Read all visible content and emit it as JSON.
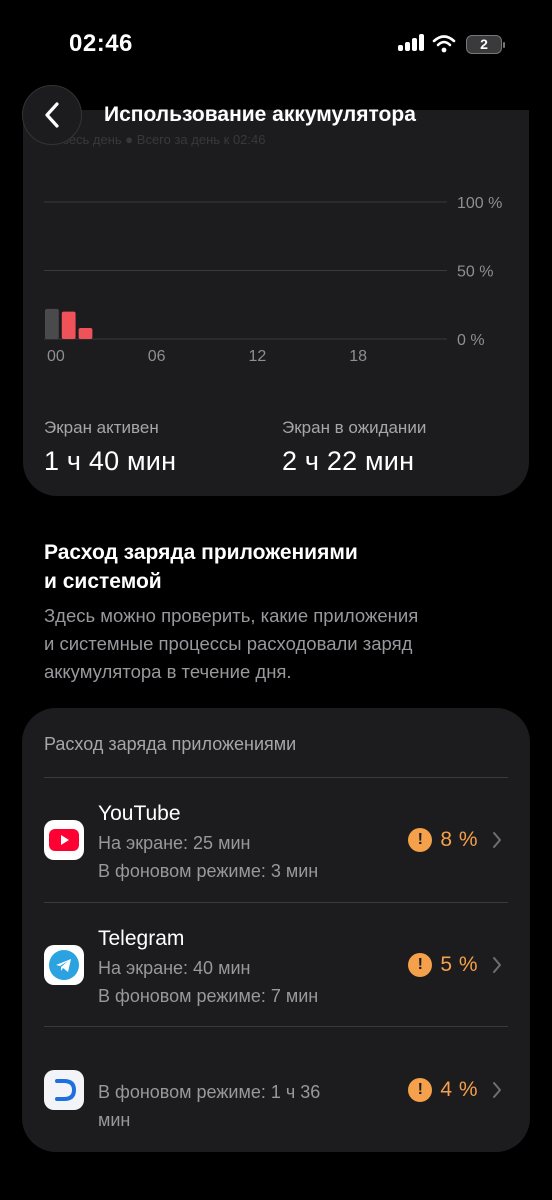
{
  "status_bar": {
    "time": "02:46",
    "battery_level": "2"
  },
  "header": {
    "title": "Использование аккумулятора"
  },
  "chart_card": {
    "faded_legend": "зесь день  ●  Всего за день к 02:46",
    "screen_active_label": "Экран активен",
    "screen_active_value": "1 ч 40 мин",
    "screen_idle_label": "Экран в ожидании",
    "screen_idle_value": "2 ч 22 мин"
  },
  "chart_data": {
    "type": "bar",
    "x_tick_labels": [
      "00",
      "06",
      "12",
      "18"
    ],
    "y_tick_labels": [
      "100 %",
      "50 %",
      "0 %"
    ],
    "ylim": [
      0,
      100
    ],
    "grid": true,
    "bars": [
      {
        "hour": 0,
        "value": 22,
        "color": "#4a4a4c"
      },
      {
        "hour": 1,
        "value": 20,
        "color": "#f0525a"
      },
      {
        "hour": 2,
        "value": 8,
        "color": "#f0525a"
      }
    ]
  },
  "section": {
    "title_line1": "Расход заряда приложениями",
    "title_line2": "и системой",
    "desc_line1": "Здесь можно проверить, какие приложения",
    "desc_line2": "и системные процессы расходовали заряд",
    "desc_line3": "аккумулятора в течение дня."
  },
  "apps_card": {
    "title": "Расход заряда приложениями",
    "apps": [
      {
        "name": "YouTube",
        "screen_time": "На экране: 25 мин",
        "background_time": "В фоновом режиме: 3 мин",
        "percent": "8 %",
        "icon": "youtube-icon"
      },
      {
        "name": "Telegram",
        "screen_time": "На экране: 40 мин",
        "background_time": "В фоновом режиме: 7 мин",
        "percent": "5 %",
        "icon": "telegram-icon"
      },
      {
        "name": "",
        "background_line1": "В фоновом режиме: 1 ч 36",
        "background_line2": "мин",
        "percent": "4 %",
        "icon": "app-d-icon"
      }
    ]
  },
  "colors": {
    "background": "#000000",
    "card": "#1c1c1e",
    "accent_warning": "#f5a04a",
    "bar_red": "#f0525a",
    "bar_gray": "#4a4a4c"
  }
}
